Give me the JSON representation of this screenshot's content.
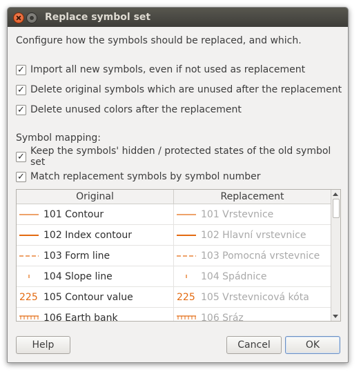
{
  "window": {
    "title": "Replace symbol set"
  },
  "intro": "Configure how the symbols should be replaced, and which.",
  "options": [
    {
      "label": "Import all new symbols, even if not used as replacement",
      "checked": true
    },
    {
      "label": "Delete original symbols which are unused after the replacement",
      "checked": true
    },
    {
      "label": "Delete unused colors after the replacement",
      "checked": true
    }
  ],
  "mapping": {
    "label": "Symbol mapping:",
    "options": [
      {
        "label": "Keep the symbols' hidden / protected states of the old symbol set",
        "checked": true
      },
      {
        "label": "Match replacement symbols by symbol number",
        "checked": true
      }
    ]
  },
  "table": {
    "columns": [
      "Original",
      "Replacement"
    ],
    "rows": [
      {
        "icon": "solid-line-symbol-icon",
        "original": "101 Contour",
        "replacement": "101 Vrstevnice"
      },
      {
        "icon": "thick-line-symbol-icon",
        "original": "102 Index contour",
        "replacement": "102 Hlavní vrstevnice"
      },
      {
        "icon": "dashed-line-symbol-icon",
        "original": "103 Form line",
        "replacement": "103 Pomocná vrstevnice"
      },
      {
        "icon": "slope-tick-symbol-icon",
        "original": "104 Slope line",
        "replacement": "104 Spádnice"
      },
      {
        "icon": "text-symbol-icon",
        "symbol_text": "225",
        "original": "105 Contour value",
        "replacement": "105 Vrstevnicová kóta"
      },
      {
        "icon": "comb-line-symbol-icon",
        "original": "106 Earth bank",
        "replacement": "106 Sráz"
      }
    ],
    "symbol_color": "#e36a10"
  },
  "buttons": {
    "help": "Help",
    "cancel": "Cancel",
    "ok": "OK"
  }
}
